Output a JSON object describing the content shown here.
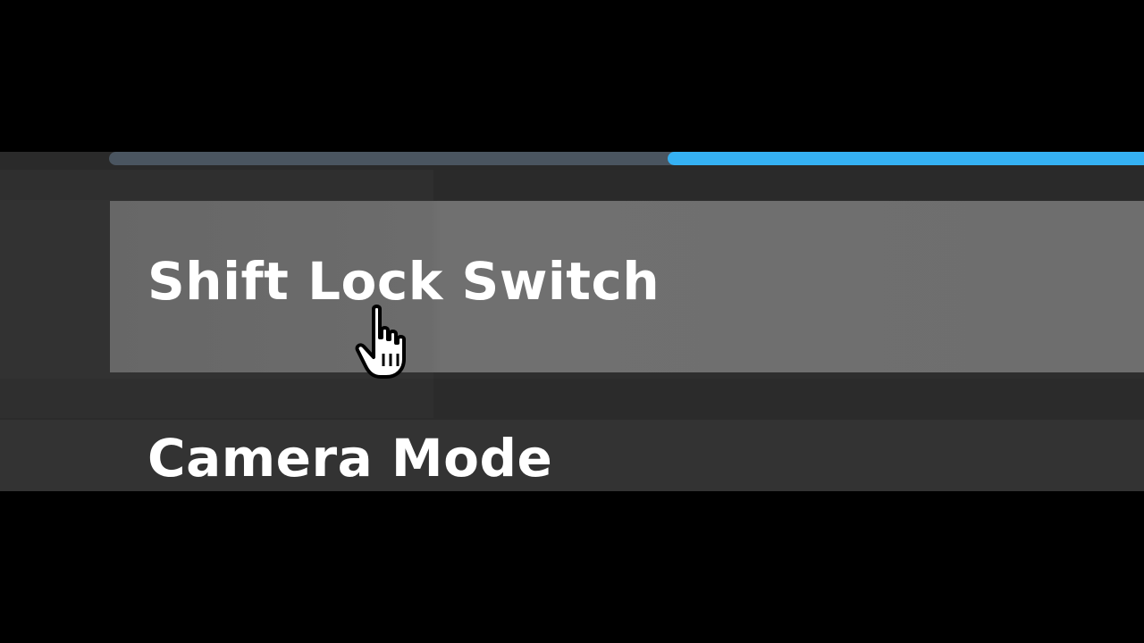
{
  "colors": {
    "background": "#000000",
    "panel": "#2c2c2c",
    "row_highlight": "#6e6e6e",
    "progress_track": "#4a5560",
    "progress_fill": "#35b1f3",
    "label_text": "#ffffff"
  },
  "top_bar": {
    "progress_fraction": 0.46
  },
  "settings": {
    "shift_lock": {
      "label": "Shift Lock Switch",
      "state": "hovered"
    },
    "camera_mode": {
      "label": "Camera Mode"
    }
  },
  "cursor": {
    "icon": "hand-pointer-icon"
  }
}
